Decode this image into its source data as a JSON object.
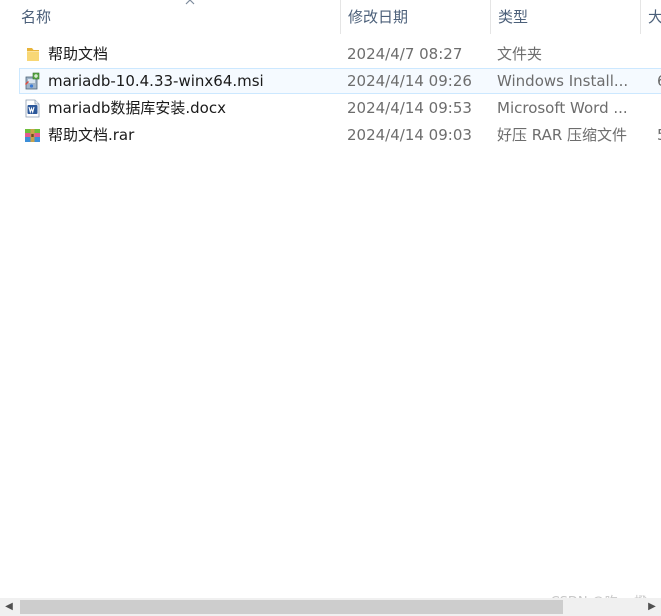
{
  "columns": {
    "name": "名称",
    "date": "修改日期",
    "type": "类型",
    "size": "大"
  },
  "files": [
    {
      "name": "帮助文档",
      "date": "2024/4/7 08:27",
      "type": "文件夹",
      "size": "",
      "icon": "folder-icon"
    },
    {
      "name": "mariadb-10.4.33-winx64.msi",
      "date": "2024/4/14 09:26",
      "type": "Windows Install...",
      "size": "6",
      "icon": "msi-installer-icon"
    },
    {
      "name": "mariadb数据库安装.docx",
      "date": "2024/4/14 09:53",
      "type": "Microsoft Word ...",
      "size": "",
      "icon": "word-document-icon"
    },
    {
      "name": "帮助文档.rar",
      "date": "2024/4/14 09:03",
      "type": "好压 RAR 压缩文件",
      "size": "5",
      "icon": "rar-archive-icon"
    }
  ],
  "selected_row": 1,
  "watermark": "CSDN @吃en橙",
  "colors": {
    "header_text": "#4c607a",
    "selection_border": "#cce8ff",
    "folder": "#f8d775",
    "word": "#2b579a"
  }
}
